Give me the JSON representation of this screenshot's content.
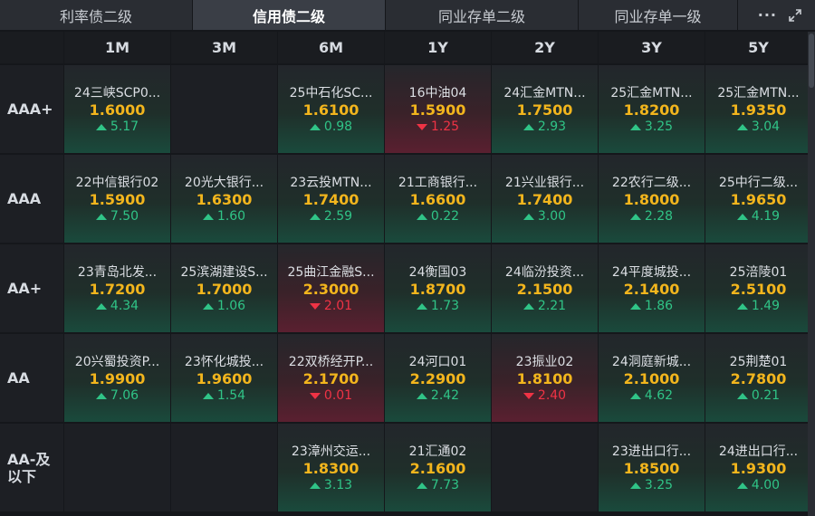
{
  "tabs": [
    "利率债二级",
    "信用债二级",
    "同业存单二级",
    "同业存单一级"
  ],
  "active_tab_index": 1,
  "toolbar": {
    "more_icon": "more-icon",
    "expand_icon": "expand-icon"
  },
  "columns": [
    "1M",
    "3M",
    "6M",
    "1Y",
    "2Y",
    "3Y",
    "5Y"
  ],
  "colors": {
    "rate": "#f2b51d",
    "up": "#30c487",
    "down": "#ef3345"
  },
  "rows": [
    {
      "label": "AAA+",
      "cells": [
        {
          "name": "24三峡SCP0...",
          "rate": "1.6000",
          "change": "5.17",
          "dir": "up"
        },
        null,
        {
          "name": "25中石化SC...",
          "rate": "1.6100",
          "change": "0.98",
          "dir": "up"
        },
        {
          "name": "16中油04",
          "rate": "1.5900",
          "change": "1.25",
          "dir": "down"
        },
        {
          "name": "24汇金MTN...",
          "rate": "1.7500",
          "change": "2.93",
          "dir": "up"
        },
        {
          "name": "25汇金MTN...",
          "rate": "1.8200",
          "change": "3.25",
          "dir": "up"
        },
        {
          "name": "25汇金MTN...",
          "rate": "1.9350",
          "change": "3.04",
          "dir": "up"
        }
      ]
    },
    {
      "label": "AAA",
      "cells": [
        {
          "name": "22中信银行02",
          "rate": "1.5900",
          "change": "7.50",
          "dir": "up"
        },
        {
          "name": "20光大银行...",
          "rate": "1.6300",
          "change": "1.60",
          "dir": "up"
        },
        {
          "name": "23云投MTN...",
          "rate": "1.7400",
          "change": "2.59",
          "dir": "up"
        },
        {
          "name": "21工商银行...",
          "rate": "1.6600",
          "change": "0.22",
          "dir": "up"
        },
        {
          "name": "21兴业银行...",
          "rate": "1.7400",
          "change": "3.00",
          "dir": "up"
        },
        {
          "name": "22农行二级...",
          "rate": "1.8000",
          "change": "2.28",
          "dir": "up"
        },
        {
          "name": "25中行二级...",
          "rate": "1.9650",
          "change": "4.19",
          "dir": "up"
        }
      ]
    },
    {
      "label": "AA+",
      "cells": [
        {
          "name": "23青岛北发...",
          "rate": "1.7200",
          "change": "4.34",
          "dir": "up"
        },
        {
          "name": "25滨湖建设S...",
          "rate": "1.7000",
          "change": "1.06",
          "dir": "up"
        },
        {
          "name": "25曲江金融S...",
          "rate": "2.3000",
          "change": "2.01",
          "dir": "down"
        },
        {
          "name": "24衡国03",
          "rate": "1.8700",
          "change": "1.73",
          "dir": "up"
        },
        {
          "name": "24临汾投资...",
          "rate": "2.1500",
          "change": "2.21",
          "dir": "up"
        },
        {
          "name": "24平度城投...",
          "rate": "2.1400",
          "change": "1.86",
          "dir": "up"
        },
        {
          "name": "25涪陵01",
          "rate": "2.5100",
          "change": "1.49",
          "dir": "up"
        }
      ]
    },
    {
      "label": "AA",
      "cells": [
        {
          "name": "20兴蜀投资P...",
          "rate": "1.9900",
          "change": "7.06",
          "dir": "up"
        },
        {
          "name": "23怀化城投...",
          "rate": "1.9600",
          "change": "1.54",
          "dir": "up"
        },
        {
          "name": "22双桥经开P...",
          "rate": "2.1700",
          "change": "0.01",
          "dir": "down"
        },
        {
          "name": "24河口01",
          "rate": "2.2900",
          "change": "2.42",
          "dir": "up"
        },
        {
          "name": "23振业02",
          "rate": "1.8100",
          "change": "2.40",
          "dir": "down"
        },
        {
          "name": "24洞庭新城...",
          "rate": "2.1000",
          "change": "4.62",
          "dir": "up"
        },
        {
          "name": "25荆楚01",
          "rate": "2.7800",
          "change": "0.21",
          "dir": "up"
        }
      ]
    },
    {
      "label": "AA-及\n以下",
      "cells": [
        null,
        null,
        {
          "name": "23漳州交运...",
          "rate": "1.8300",
          "change": "3.13",
          "dir": "up"
        },
        {
          "name": "21汇通02",
          "rate": "2.1600",
          "change": "7.73",
          "dir": "up"
        },
        null,
        {
          "name": "23进出口行...",
          "rate": "1.8500",
          "change": "3.25",
          "dir": "up"
        },
        {
          "name": "24进出口行...",
          "rate": "1.9300",
          "change": "4.00",
          "dir": "up"
        }
      ]
    }
  ]
}
